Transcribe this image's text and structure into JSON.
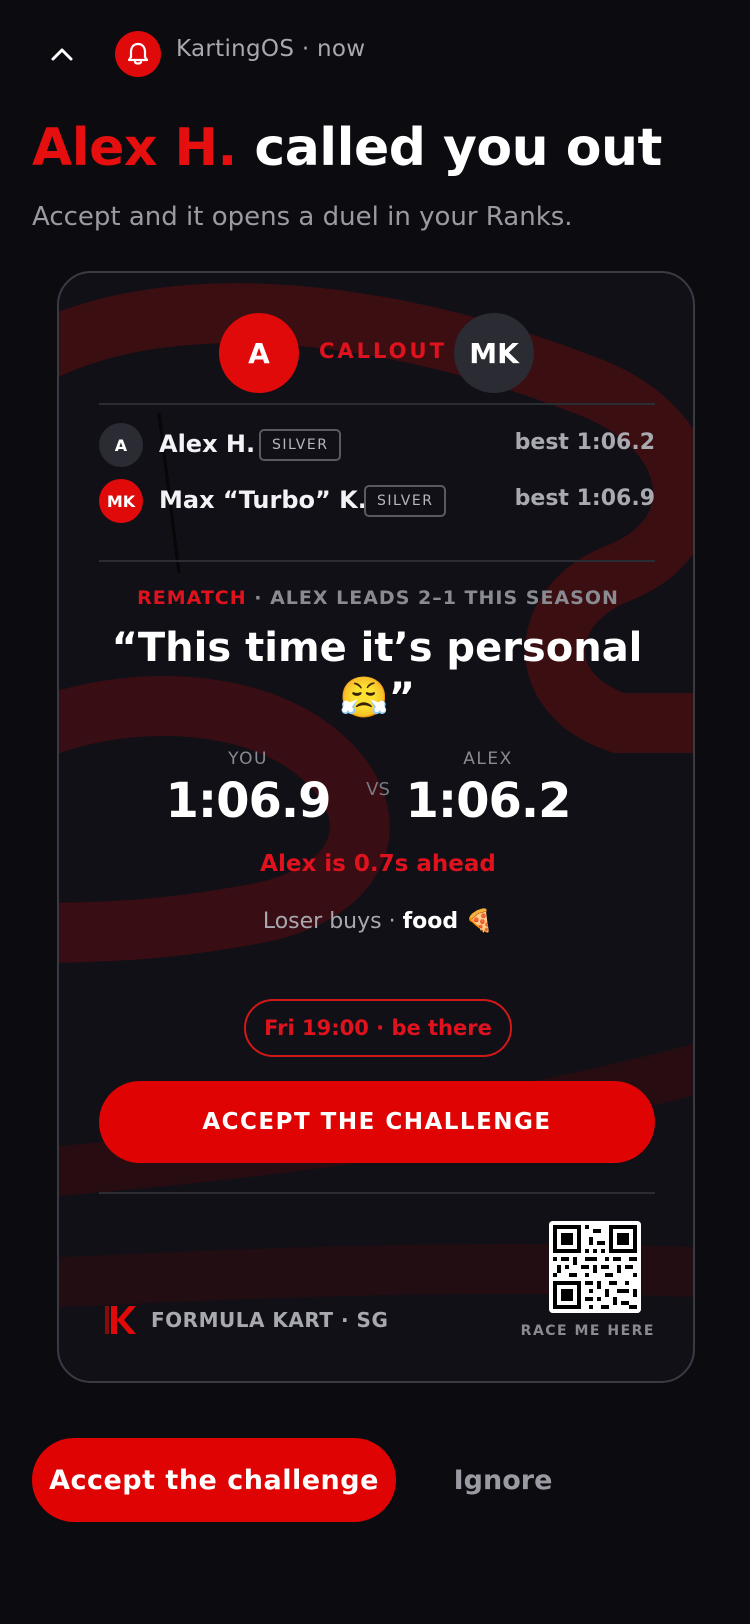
{
  "notification": {
    "app_line": "KartingOS · now",
    "icons": {
      "collapse": "chevron-up-icon",
      "app": "bell-icon"
    }
  },
  "headline": {
    "name": "Alex H.",
    "rest": "called you out"
  },
  "subline": "Accept and it opens a duel in your Ranks.",
  "card": {
    "challenger_initial": "A",
    "opponent_initials": "MK",
    "callout_label": "CALLOUT",
    "players": [
      {
        "initial": "A",
        "name": "Alex H.",
        "tier": "SILVER",
        "best": "best 1:06.2",
        "avatar_color": "#2a2b33"
      },
      {
        "initial": "MK",
        "name": "Max “Turbo” K.",
        "tier": "SILVER",
        "best": "best 1:06.9",
        "avatar_color": "#e00a0a"
      }
    ],
    "rematch_tag": "REMATCH",
    "rematch_rest": " · ALEX LEADS 2–1 THIS SEASON",
    "quote": "“This time it’s personal 😤”",
    "you_label": "YOU",
    "you_time": "1:06.9",
    "vs": "VS",
    "opp_label": "ALEX",
    "opp_time": "1:06.2",
    "gap_text": "Alex is 0.7s ahead",
    "stake_prefix": "Loser buys · ",
    "stake_item": "food 🍕",
    "when": "Fri 19:00 · be there",
    "accept_label": "ACCEPT THE CHALLENGE",
    "venue": "FORMULA KART · SG",
    "qr_label": "RACE ME HERE"
  },
  "actions": {
    "accept": "Accept the challenge",
    "ignore": "Ignore"
  },
  "colors": {
    "accent": "#e00303",
    "background": "#0b0b10",
    "card": "#101016"
  }
}
